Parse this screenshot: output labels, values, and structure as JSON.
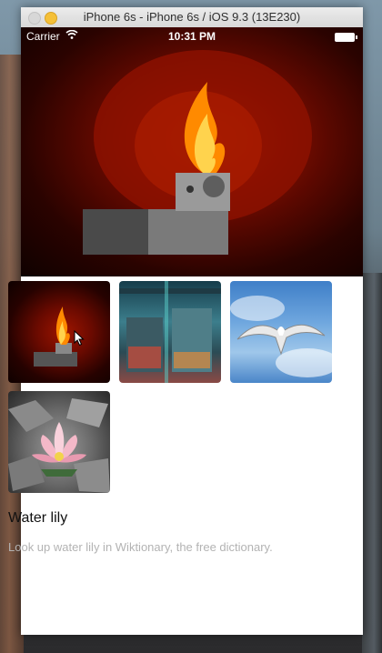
{
  "window": {
    "title": "iPhone 6s - iPhone 6s / iOS 9.3 (13E230)"
  },
  "status_bar": {
    "carrier": "Carrier",
    "time": "10:31 PM",
    "icons": [
      "wifi-icon",
      "battery-icon"
    ]
  },
  "hero_image": {
    "subject": "lighter-flame-image"
  },
  "gallery": {
    "thumbnails": [
      {
        "image": "lighter-flame-thumbnail"
      },
      {
        "image": "graffiti-machine-room-thumbnail"
      },
      {
        "image": "seagull-sky-thumbnail"
      },
      {
        "image": "water-lily-thumbnail"
      }
    ]
  },
  "detail": {
    "title": "Water lily",
    "description": "Look up water lily in Wiktionary, the free dictionary."
  },
  "colors": {
    "accent_yellow": "#f5c038",
    "description_gray": "#b3b3b3"
  }
}
